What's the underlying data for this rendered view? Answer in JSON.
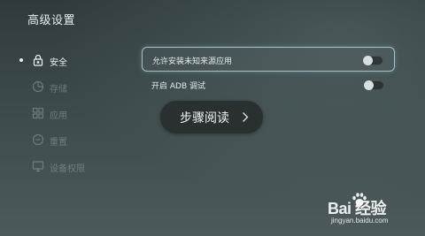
{
  "header": {
    "title": "高级设置"
  },
  "sidebar": {
    "items": [
      {
        "label": "安全",
        "icon": "lock-icon",
        "active": true
      },
      {
        "label": "存储",
        "icon": "storage-icon",
        "active": false
      },
      {
        "label": "应用",
        "icon": "apps-icon",
        "active": false
      },
      {
        "label": "重置",
        "icon": "reset-icon",
        "active": false
      },
      {
        "label": "设备权限",
        "icon": "monitor-icon",
        "active": false
      }
    ]
  },
  "settings": {
    "rows": [
      {
        "label": "允许安装未知来源应用",
        "enabled": false,
        "focused": true
      },
      {
        "label": "开启 ADB 调试",
        "enabled": false,
        "focused": false
      }
    ]
  },
  "overlay": {
    "label": "步骤阅读",
    "icon": "chevron-right-icon"
  },
  "watermark": {
    "brand": "Bai  经验",
    "url": "jingyan.baidu.com"
  },
  "colors": {
    "focus_border": "#9fc4c8",
    "background": "#3d4a4b"
  }
}
